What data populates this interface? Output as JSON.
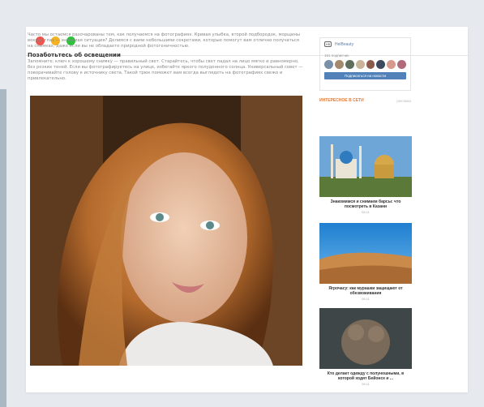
{
  "window": {
    "dots": [
      "red",
      "yellow",
      "green"
    ]
  },
  "article": {
    "intro": "Часто мы остаемся разочарованы тем, как получаемся на фотографиях. Кривая улыбка, второй подбородок, морщины вокруг глаз — знакомая ситуация? Делимся с вами небольшими секретами, которые помогут вам отлично получаться на снимках, даже если вы не обладаете природной фотогеничностью.",
    "heading": "Позаботьтесь об освещении",
    "body": "Запомните: ключ к хорошему снимку — правильный свет. Старайтесь, чтобы свет падал на лицо мягко и равномерно, без резких теней. Если вы фотографируетесь на улице, избегайте яркого полуденного солнца. Универсальный совет — поворачивайте голову к источнику света. Такой трюк поможет вам всегда выглядеть на фотографиях свежо и привлекательно."
  },
  "sidebar": {
    "group_name": "HelBeauty",
    "members": "161 подписчик",
    "subscribe": "Подписаться на новости",
    "section_title": "ИНТЕРЕСНОЕ В СЕТИ",
    "section_meta": "реклама",
    "cards": [
      {
        "caption": "Знакомимся и снимаем барсы: что посмотреть в Казани",
        "date": "08.11"
      },
      {
        "caption": "Ягрочасу: как мурашки защищают от обезвоживания",
        "date": "08.11"
      },
      {
        "caption": "Кто делает одежду с полуношными, в которой ходят Бейонсе и ...",
        "date": "08.11"
      }
    ]
  },
  "colors": {
    "accent": "#e07b39",
    "button": "#5181b8",
    "side_accent": "#a9b8c3"
  }
}
